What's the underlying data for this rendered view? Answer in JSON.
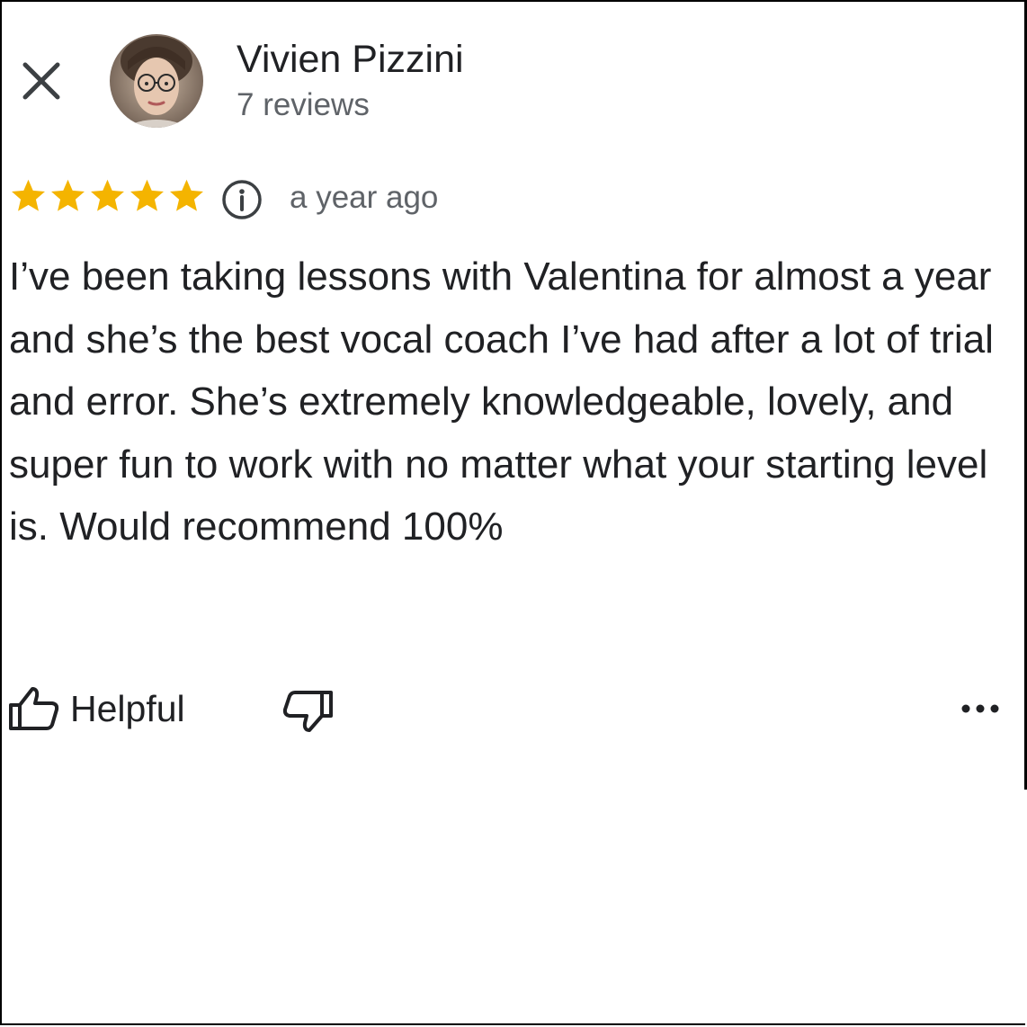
{
  "reviewer": {
    "name": "Vivien Pizzini",
    "reviews_count": "7 reviews"
  },
  "rating": {
    "stars": 5,
    "max_stars": 5,
    "star_color": "#f4b400"
  },
  "review": {
    "time": "a year ago",
    "text": "I’ve been taking lessons with Valentina for almost a year and she’s the best vocal coach I’ve had after a lot of trial and error. She’s extremely knowledgeable, lovely, and super fun to work with no matter what your starting level is. Would recommend 100%"
  },
  "actions": {
    "helpful_label": "Helpful"
  },
  "icons": {
    "close": "close-icon",
    "avatar": "avatar",
    "star": "star-icon",
    "info": "info-icon",
    "thumbs_up": "thumbs-up-icon",
    "thumbs_down": "thumbs-down-icon",
    "more": "more-options-icon"
  }
}
